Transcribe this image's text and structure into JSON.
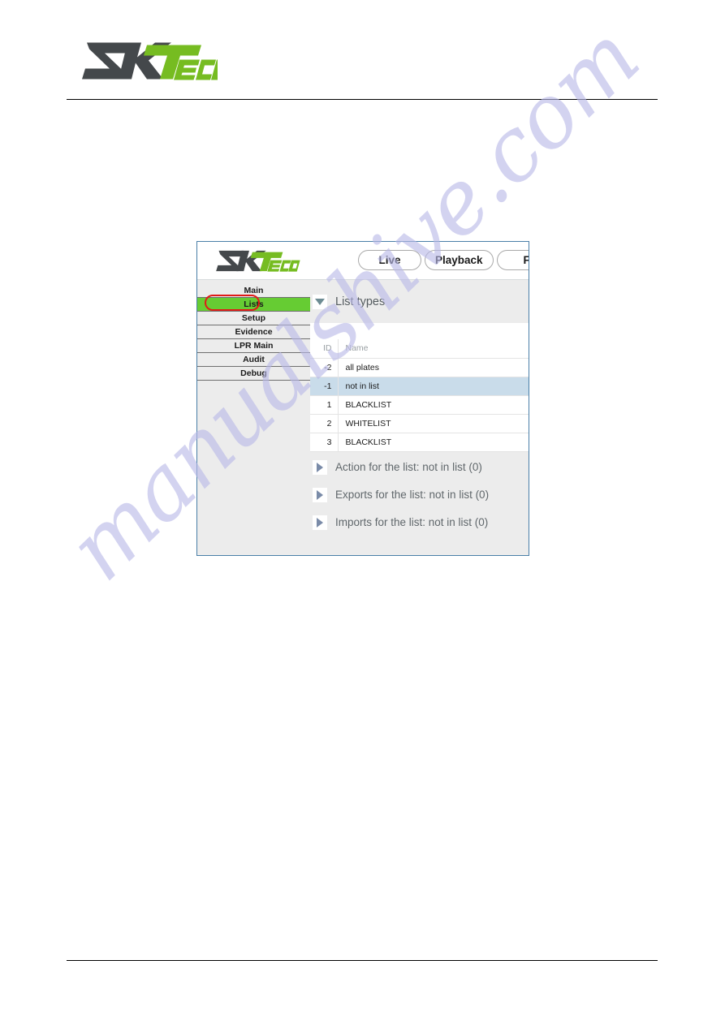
{
  "document": {
    "brand_logo": "zkteco-logo",
    "logo_text_dark": "ZK",
    "logo_text_accent": "Teco",
    "watermark_text": "manualshive.com"
  },
  "colors": {
    "brand_green": "#66cc33",
    "brand_dark": "#44484b",
    "highlight_red": "#e01b18",
    "row_selected_blue": "#c9dcea",
    "panel_border_blue": "#4a7fa8",
    "watermark_purple": "#b9b9e8"
  },
  "app": {
    "header": {
      "logo": "zkteco-logo",
      "tabs": [
        {
          "label": "Live",
          "clipped": false
        },
        {
          "label": "Playback",
          "clipped": false
        },
        {
          "label": "Fi",
          "clipped": true
        }
      ]
    },
    "sidebar": {
      "items": [
        {
          "label": "Main",
          "active": false
        },
        {
          "label": "Lists",
          "active": true
        },
        {
          "label": "Setup",
          "active": false
        },
        {
          "label": "Evidence",
          "active": false
        },
        {
          "label": "LPR Main",
          "active": false
        },
        {
          "label": "Audit",
          "active": false
        },
        {
          "label": "Debug",
          "active": false
        }
      ]
    },
    "content": {
      "section": {
        "title": "List types",
        "expanded": true,
        "toggle_icon": "triangle-down-icon"
      },
      "table": {
        "columns": [
          "ID",
          "Name"
        ],
        "rows": [
          {
            "id": "-2",
            "name": "all plates",
            "selected": false
          },
          {
            "id": "-1",
            "name": "not in list",
            "selected": true
          },
          {
            "id": "1",
            "name": "BLACKLIST",
            "selected": false
          },
          {
            "id": "2",
            "name": "WHITELIST",
            "selected": false
          },
          {
            "id": "3",
            "name": "BLACKLIST",
            "selected": false
          }
        ]
      },
      "accordions": [
        {
          "label": "Action for the list: not in list (0)",
          "expanded": false,
          "toggle_icon": "triangle-right-icon"
        },
        {
          "label": "Exports for the list: not in list (0)",
          "expanded": false,
          "toggle_icon": "triangle-right-icon"
        },
        {
          "label": "Imports for the list: not in list (0)",
          "expanded": false,
          "toggle_icon": "triangle-right-icon"
        }
      ]
    }
  }
}
